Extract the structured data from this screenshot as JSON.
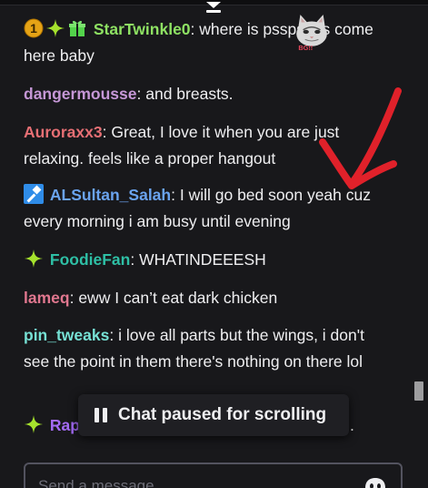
{
  "messages": [
    {
      "username": "StarTwinkle0",
      "color": "#8ee163",
      "text": "where is psspspps come here baby",
      "emote": "cat-emote",
      "emote_text": "BG!!",
      "badges": [
        "gift-count-badge",
        "star-badge",
        "gift-badge"
      ],
      "gift_count": "1"
    },
    {
      "username": "dangermousse",
      "color": "#c597d6",
      "text": "and breasts.",
      "badges": []
    },
    {
      "username": "Auroraxx3",
      "color": "#e66f74",
      "text": "Great, I love it when you are just relaxing. feels like a proper hangout",
      "badges": []
    },
    {
      "username": "ALSultan_Salah",
      "color": "#6aa3ee",
      "text": "I will go bed soon yeah cuz every morning i am busy until evening",
      "badges": [
        "hammer-badge"
      ]
    },
    {
      "username": "FoodieFan",
      "color": "#2ebfa5",
      "text": "WHATINDEEESH",
      "badges": [
        "star-badge"
      ]
    },
    {
      "username": "lameq",
      "color": "#e0778f",
      "text": "eww I can’t eat dark chicken",
      "badges": []
    },
    {
      "username": "pin_tweaks",
      "color": "#76e0d4",
      "text": "i love all parts but the wings, i don't see the point in them there's nothing on there lol",
      "badges": []
    },
    {
      "username": "Rap",
      "color": "#a46bf5",
      "text": ".",
      "badges": [
        "star-badge"
      ]
    }
  ],
  "colon": ":",
  "pause_banner": {
    "label": "Chat paused for scrolling",
    "icon": "pause-icon"
  },
  "input": {
    "placeholder": "Send a message",
    "value": ""
  },
  "colors": {
    "background": "#18181b",
    "text": "#efeff1",
    "annotation": "#e0212a"
  }
}
